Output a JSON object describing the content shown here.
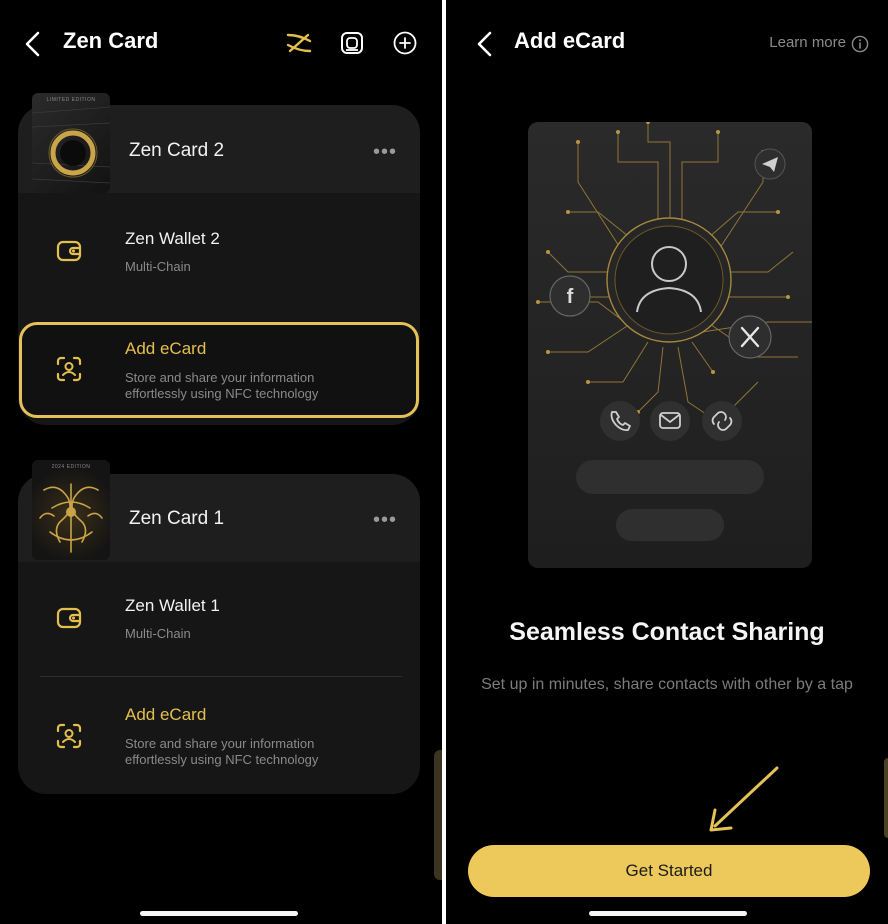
{
  "colors": {
    "gold": "#e3c04e",
    "button": "#ecc95a",
    "background": "#000000",
    "panel": "#161616"
  },
  "left_screen": {
    "header": {
      "title": "Zen Card",
      "icons": [
        "back-icon",
        "zen-logo-icon",
        "scan-icon",
        "add-circle-icon"
      ]
    },
    "cards": [
      {
        "name": "Zen Card 2",
        "more": "•••",
        "thumb_caption": "LIMITED EDITION",
        "rows": [
          {
            "title": "Zen Wallet 2",
            "subtitle": "Multi-Chain",
            "icon": "wallet-icon"
          },
          {
            "title": "Add eCard",
            "subtitle_line1": "Store and share your information",
            "subtitle_line2": "effortlessly using NFC technology",
            "icon": "ecard-icon",
            "highlighted": true
          }
        ]
      },
      {
        "name": "Zen Card 1",
        "more": "•••",
        "thumb_caption": "2024 EDITION",
        "rows": [
          {
            "title": "Zen Wallet 1",
            "subtitle": "Multi-Chain",
            "icon": "wallet-icon"
          },
          {
            "title": "Add eCard",
            "subtitle_line1": "Store and share your information",
            "subtitle_line2": "effortlessly using NFC technology",
            "icon": "ecard-icon"
          }
        ]
      }
    ]
  },
  "right_screen": {
    "header": {
      "title": "Add eCard",
      "learn_more": "Learn more",
      "icons": [
        "back-icon",
        "info-icon"
      ]
    },
    "illustration_icons": [
      "telegram-icon",
      "facebook-icon",
      "x-icon",
      "phone-icon",
      "mail-icon",
      "link-icon",
      "avatar-icon"
    ],
    "heading": "Seamless Contact Sharing",
    "subtext": "Set up in minutes, share contacts with other by a tap",
    "cta_label": "Get Started"
  }
}
